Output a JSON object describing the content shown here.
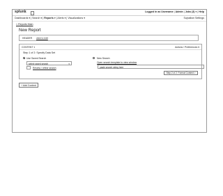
{
  "topbar": {
    "logo": "splunk",
    "logo_suffix": ">",
    "user_links": [
      "Logged in as Username",
      "Admin",
      "Jobs (3)",
      "Help"
    ]
  },
  "navbar": {
    "items": [
      "Dashboards",
      "Search",
      "Reports",
      "Alerts",
      "Visualizations"
    ],
    "active": "Reports",
    "right": "Sujnalism Settings"
  },
  "breadcrumb": "< Reports Main",
  "page_title": "New Report",
  "header_panel": {
    "label": "HEADER",
    "link": "click to edit"
  },
  "content_panel": {
    "label": "CONTENT 1",
    "actions": "Actions / Preferences",
    "step": "Step 1 of 2: Specify Data Set",
    "saved_search": {
      "radio_label": "Use Saved Search",
      "select_value": "select saved search",
      "checkbox_label": "Review / refine search"
    },
    "new_search": {
      "radio_label": "New Search",
      "link": "Open search template to view window",
      "input_value": "paste search string here"
    },
    "next_button": "Step 2 of 2: Format Content >"
  },
  "add_content_button": "+ Add Content"
}
